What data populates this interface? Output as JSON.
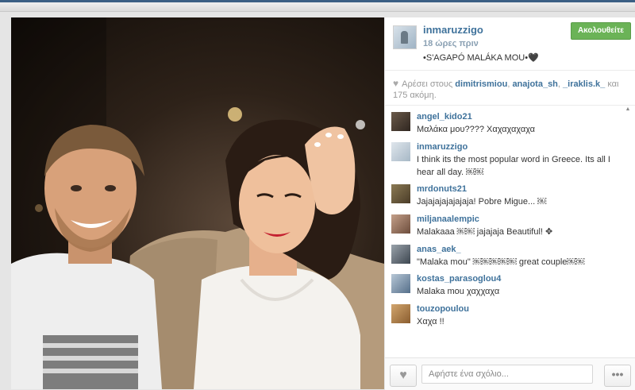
{
  "post": {
    "owner": "inmaruzzigo",
    "time_ago": "18 ώρες πριν",
    "caption": "•S'AGAPÓ MALÁKA MOU•🖤",
    "follow_label": "Ακολουθείτε"
  },
  "likes": {
    "prefix": "Αρέσει στους",
    "user1": "dimitrismiou",
    "user2": "anajota_sh",
    "user3": "_iraklis.k_",
    "suffix": "και 175 ακόμη."
  },
  "comments": [
    {
      "user": "angel_kido21",
      "text": "Μαλάκα μου???? Χαχαχαχαχα"
    },
    {
      "user": "inmaruzzigo",
      "text": "I think its the most popular word in Greece. Its all I hear all day. ￼￼"
    },
    {
      "user": "mrdonuts21",
      "text": "Jajajajajajajaja! Pobre Migue... ￼"
    },
    {
      "user": "miljanaalempic",
      "text": "Malakaaa ￼￼ jajajaja Beautiful! ✥"
    },
    {
      "user": "anas_aek_",
      "text": "\"Malaka mou\" ￼￼￼￼￼ great couple￼￼"
    },
    {
      "user": "kostas_parasoglou4",
      "text": "Malaka mou χαχχαχα"
    },
    {
      "user": "touzopoulou",
      "text": "Χαχα !!"
    }
  ],
  "footer": {
    "comment_placeholder": "Αφήστε ένα σχόλιο...",
    "more_label": "•••"
  },
  "icons": {
    "like": "heart-icon",
    "more": "more-icon"
  },
  "colors": {
    "username": "#3f729b",
    "follow_button": "#6bb357"
  }
}
